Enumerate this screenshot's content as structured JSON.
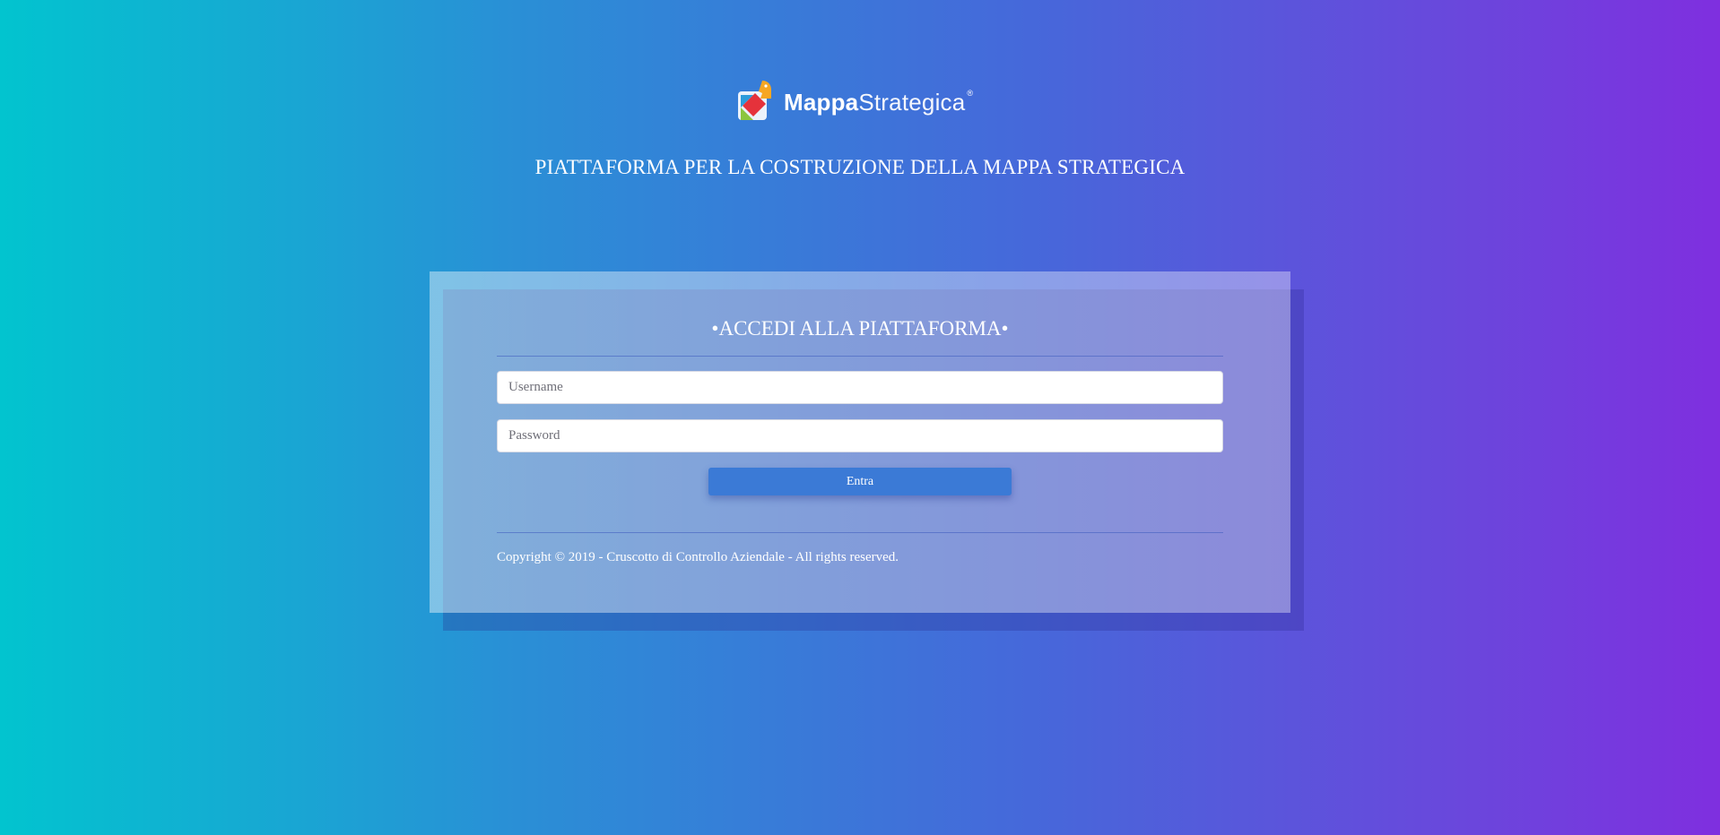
{
  "brand": {
    "name_bold": "Mappa",
    "name_light": "Strategica",
    "registered_mark": "®",
    "colors": {
      "red": "#e5323b",
      "green": "#8cc63e",
      "orange": "#f6a623",
      "blue": "#2d9cdb"
    }
  },
  "header": {
    "title": "PIATTAFORMA PER LA COSTRUZIONE DELLA MAPPA STRATEGICA"
  },
  "login": {
    "heading": "•ACCEDI ALLA PIATTAFORMA•",
    "username_placeholder": "Username",
    "username_value": "",
    "password_placeholder": "Password",
    "password_value": "",
    "submit_label": "Entra"
  },
  "footer": {
    "copyright": "Copyright © 2019 - Cruscotto di Controllo Aziendale - All rights reserved."
  },
  "theme": {
    "gradient_start": "#02c4cf",
    "gradient_end": "#7f2fdf",
    "button_color": "#3b7ad6"
  }
}
